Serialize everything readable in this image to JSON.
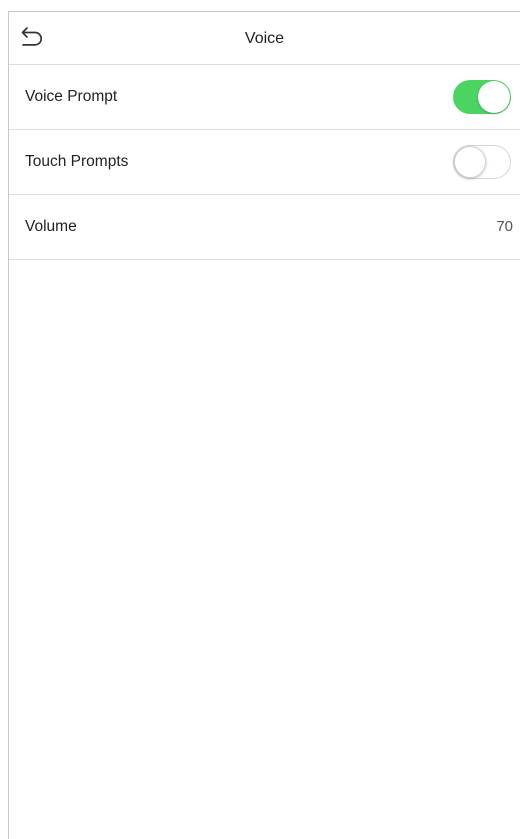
{
  "header": {
    "title": "Voice",
    "back_icon": "back-arrow-icon"
  },
  "settings": [
    {
      "label": "Voice Prompt",
      "type": "toggle",
      "enabled": true
    },
    {
      "label": "Touch Prompts",
      "type": "toggle",
      "enabled": false
    },
    {
      "label": "Volume",
      "type": "value",
      "value": "70"
    }
  ],
  "colors": {
    "toggle_on": "#4cd463",
    "toggle_off_border": "#d6d6d6",
    "divider": "#dedede"
  }
}
